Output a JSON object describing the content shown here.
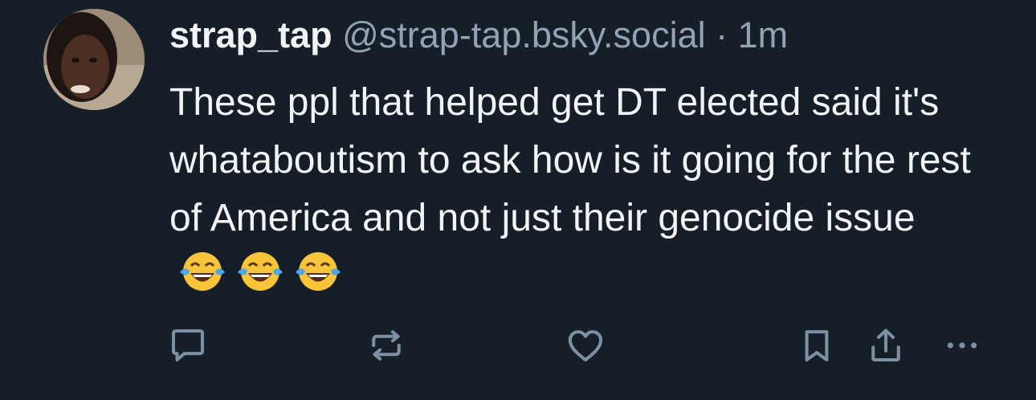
{
  "post": {
    "display_name": "strap_tap",
    "handle": "@strap-tap.bsky.social",
    "separator": "·",
    "time": "1m",
    "text": "These ppl that helped get DT elected said it's whataboutism to ask how is it going for the rest of America and not just their genocide issue",
    "emoji_names": [
      "face-with-tears-of-joy",
      "face-with-tears-of-joy",
      "face-with-tears-of-joy"
    ]
  },
  "actions": {
    "icons": [
      "reply-icon",
      "repost-icon",
      "like-icon",
      "bookmark-icon",
      "share-icon",
      "more-icon"
    ]
  },
  "colors": {
    "background": "#161e27",
    "text": "#f1f3f5",
    "muted": "#93a3b5",
    "icon": "#7d8fa3"
  }
}
